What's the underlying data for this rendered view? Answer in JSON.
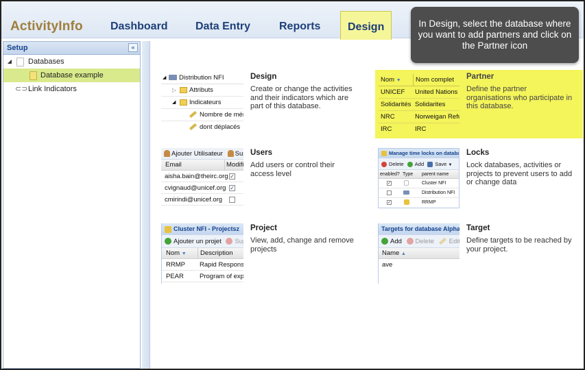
{
  "app": {
    "brand": "ActivityInfo",
    "nav": [
      {
        "label": "Dashboard"
      },
      {
        "label": "Data Entry"
      },
      {
        "label": "Reports"
      },
      {
        "label": "Design",
        "active": true
      }
    ],
    "callout": "In Design, select the database where you want to add partners and click on the Partner icon",
    "accent_color": "#f4f45b",
    "brand_color": "#a07e3c",
    "nav_color": "#1d3f77"
  },
  "sidebar": {
    "title": "Setup",
    "collapse_icon": "double-chevron-left-icon",
    "items": [
      {
        "label": "Databases",
        "icon": "database-icon",
        "expanded": true
      },
      {
        "label": "Database example",
        "icon": "database-icon",
        "selected": true
      },
      {
        "label": "Link Indicators",
        "icon": "link-icon"
      }
    ]
  },
  "panels": {
    "design": {
      "title": "Design",
      "desc": "Create or change the activities and their indicators which are part of this database.",
      "thumb": {
        "root": "Distribution NFI",
        "children": [
          "Attributs",
          "Indicateurs"
        ],
        "leaves": [
          "Nombre de mén",
          "dont déplacés"
        ]
      }
    },
    "partner": {
      "title": "Partner",
      "desc": "Define the partner organisations who participate in this database.",
      "thumb": {
        "headers": [
          "Nom",
          "Nom complet"
        ],
        "rows": [
          [
            "UNICEF",
            "United Nations Ch"
          ],
          [
            "Solidarités",
            "Solidarites"
          ],
          [
            "NRC",
            "Norweigan Refug"
          ],
          [
            "IRC",
            "IRC"
          ]
        ]
      }
    },
    "users": {
      "title": "Users",
      "desc": "Add users or control their access level",
      "thumb": {
        "toolbar": [
          "Ajouter Utilisateur",
          "Supp"
        ],
        "headers": [
          "Email",
          "Modifie"
        ],
        "rows": [
          {
            "email": "aisha.bain@theirc.org",
            "checked": true
          },
          {
            "email": "cvignaud@unicef.org",
            "checked": true
          },
          {
            "email": "cmirindi@unicef.org",
            "checked": false
          }
        ]
      }
    },
    "locks": {
      "title": "Locks",
      "desc": "Lock databases, activities or projects to prevent users to add or change data",
      "thumb": {
        "bar": "Manage time locks on databases,",
        "toolbar": [
          "Delete",
          "Add",
          "Save"
        ],
        "headers": [
          "enabled?",
          "Type",
          "parent name"
        ],
        "rows": [
          {
            "checked": true,
            "name": "Cluster NFI"
          },
          {
            "checked": false,
            "name": "Distribution NFI"
          },
          {
            "checked": true,
            "name": "RRMP"
          }
        ]
      }
    },
    "project": {
      "title": "Project",
      "desc": "View, add, change and remove projects",
      "thumb": {
        "bar": "Cluster NFI - Projectsz",
        "toolbar": [
          "Ajouter un projet",
          "Supp"
        ],
        "headers": [
          "Nom",
          "Description"
        ],
        "rows": [
          [
            "RRMP",
            "Rapid Response t"
          ],
          [
            "PEAR",
            "Program of expan"
          ]
        ]
      }
    },
    "target": {
      "title": "Target",
      "desc": "Define targets to be reached by your project.",
      "thumb": {
        "bar": "Targets for database Alpha",
        "toolbar": [
          "Add",
          "Delete",
          "Edit"
        ],
        "headers": [
          "Name"
        ],
        "rows": [
          "ave"
        ]
      }
    }
  }
}
